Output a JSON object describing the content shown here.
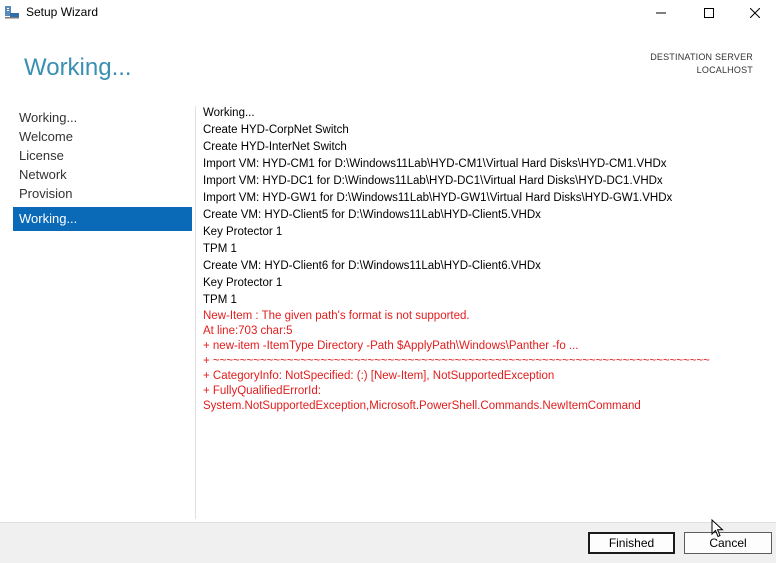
{
  "window": {
    "title": "Setup Wizard"
  },
  "header": {
    "heading": "Working...",
    "destination_label": "DESTINATION SERVER",
    "destination_value": "LOCALHOST"
  },
  "nav": {
    "items": [
      {
        "label": "Working..."
      },
      {
        "label": "Welcome"
      },
      {
        "label": "License"
      },
      {
        "label": "Network"
      },
      {
        "label": "Provision"
      }
    ],
    "active": {
      "label": "Working..."
    }
  },
  "log": {
    "lines": [
      "Working...",
      "Create HYD-CorpNet Switch",
      "Create HYD-InterNet Switch",
      "Import VM: HYD-CM1 for D:\\Windows11Lab\\HYD-CM1\\Virtual Hard Disks\\HYD-CM1.VHDx",
      "Import VM: HYD-DC1 for D:\\Windows11Lab\\HYD-DC1\\Virtual Hard Disks\\HYD-DC1.VHDx",
      "Import VM: HYD-GW1 for D:\\Windows11Lab\\HYD-GW1\\Virtual Hard Disks\\HYD-GW1.VHDx",
      "Create VM: HYD-Client5 for D:\\Windows11Lab\\HYD-Client5.VHDx",
      "Key Protector 1",
      "TPM 1",
      "Create VM: HYD-Client6 for D:\\Windows11Lab\\HYD-Client6.VHDx",
      "Key Protector 1",
      "TPM 1"
    ],
    "errors": [
      "New-Item : The given path's format is not supported.",
      "At line:703 char:5",
      "+      new-item -ItemType Directory -Path $ApplyPath\\Windows\\Panther -fo ...",
      "+      ~~~~~~~~~~~~~~~~~~~~~~~~~~~~~~~~~~~~~~~~~~~~~~~~~~~~~~~~~~~~~~~~~~~~~~~~~~",
      "+ CategoryInfo: NotSpecified: (:) [New-Item], NotSupportedException",
      "+ FullyQualifiedErrorId:",
      "System.NotSupportedException,Microsoft.PowerShell.Commands.NewItemCommand"
    ],
    "error_color": "#e21d1d"
  },
  "footer": {
    "finished_label": "Finished",
    "cancel_label": "Cancel"
  },
  "colors": {
    "accent": "#0a6ab8",
    "heading": "#3a8fb2"
  }
}
